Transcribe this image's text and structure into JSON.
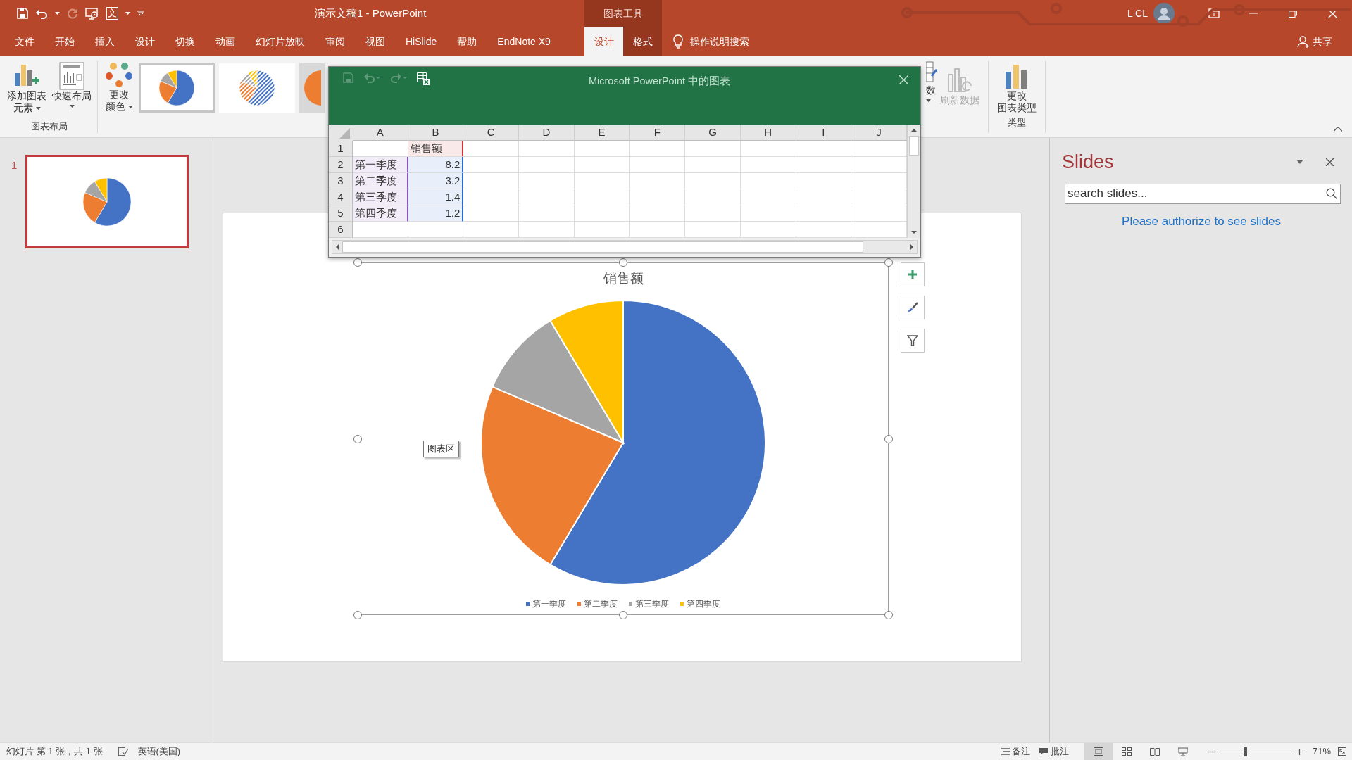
{
  "quick_access": {
    "glyph": "文"
  },
  "window": {
    "title": "演示文稿1  -  PowerPoint",
    "context": "图表工具",
    "user": "L CL"
  },
  "tabs": [
    {
      "label": "文件",
      "kind": "normal",
      "selected": false
    },
    {
      "label": "开始",
      "kind": "normal",
      "selected": false
    },
    {
      "label": "插入",
      "kind": "normal",
      "selected": false
    },
    {
      "label": "设计",
      "kind": "normal",
      "selected": false
    },
    {
      "label": "切换",
      "kind": "normal",
      "selected": false
    },
    {
      "label": "动画",
      "kind": "normal",
      "selected": false
    },
    {
      "label": "幻灯片放映",
      "kind": "normal",
      "selected": false
    },
    {
      "label": "审阅",
      "kind": "normal",
      "selected": false
    },
    {
      "label": "视图",
      "kind": "normal",
      "selected": false
    },
    {
      "label": "HiSlide",
      "kind": "normal",
      "selected": false
    },
    {
      "label": "帮助",
      "kind": "normal",
      "selected": false
    },
    {
      "label": "EndNote X9",
      "kind": "normal",
      "selected": false
    },
    {
      "label": "设计",
      "kind": "context",
      "selected": true
    },
    {
      "label": "格式",
      "kind": "context",
      "selected": false
    }
  ],
  "tell_me": "操作说明搜索",
  "share": "共享",
  "ribbon": {
    "layout_group": {
      "label": "图表布局",
      "buttons": [
        {
          "kind": "add-element",
          "lines": [
            "添加图表",
            "元素"
          ],
          "dropdown": true
        },
        {
          "kind": "quick-layout",
          "lines": [
            "快速布局"
          ],
          "dropdown": true
        }
      ]
    },
    "color_button": {
      "lines": [
        "更改",
        "颜色"
      ],
      "dropdown": true
    },
    "styles": [
      {
        "kind": "solid",
        "selected": true
      },
      {
        "kind": "hatched",
        "selected": false
      },
      {
        "kind": "shaded",
        "selected": false
      }
    ],
    "data_button": {
      "text": "数",
      "dropdown": true
    },
    "refresh_button": {
      "label": "刷新数据",
      "disabled": true
    },
    "type_group": {
      "label": "类型",
      "lines": [
        "更改",
        "图表类型"
      ]
    }
  },
  "excel": {
    "title": "Microsoft PowerPoint 中的图表",
    "columns": [
      "A",
      "B",
      "C",
      "D",
      "E",
      "F",
      "G",
      "H",
      "I",
      "J"
    ],
    "rows": [
      {
        "label": "1",
        "cells": {
          "B": {
            "text": "销售额",
            "color": "#d13438"
          }
        }
      },
      {
        "label": "2",
        "cells": {
          "A": {
            "text": "第一季度",
            "color": "#8854c0"
          },
          "B": {
            "text": "8.2",
            "color": "#2b6bd1"
          }
        }
      },
      {
        "label": "3",
        "cells": {
          "A": {
            "text": "第二季度",
            "color": "#8854c0"
          },
          "B": {
            "text": "3.2",
            "color": "#2b6bd1"
          }
        }
      },
      {
        "label": "4",
        "cells": {
          "A": {
            "text": "第三季度",
            "color": "#8854c0"
          },
          "B": {
            "text": "1.4",
            "color": "#2b6bd1"
          }
        }
      },
      {
        "label": "5",
        "cells": {
          "A": {
            "text": "第四季度",
            "color": "#8854c0"
          },
          "B": {
            "text": "1.2",
            "color": "#2b6bd1"
          }
        }
      },
      {
        "label": "6",
        "cells": {}
      }
    ]
  },
  "thumbnails": [
    {
      "number": "1",
      "selected": true
    }
  ],
  "slide": {
    "chart_data": {
      "type": "pie",
      "title": "销售额",
      "categories": [
        "第一季度",
        "第二季度",
        "第三季度",
        "第四季度"
      ],
      "values": [
        58.57,
        22.86,
        10,
        8.57
      ],
      "legend": "bottom"
    },
    "slices": [
      {
        "color": "#4472c4"
      },
      {
        "color": "#ed7d31"
      },
      {
        "color": "#a5a5a5"
      },
      {
        "color": "#ffc000"
      }
    ],
    "tooltip": "图表区"
  },
  "slides_pane": {
    "title": "Slides",
    "placeholder": "search slides...",
    "message": "Please authorize to see slides"
  },
  "status_bar": {
    "slide_info": "幻灯片 第 1 张，共 1 张",
    "language": "英语(美国)",
    "notes": "备注",
    "comments": "批注",
    "views": [
      {
        "kind": "normal",
        "selected": true
      },
      {
        "kind": "sorter",
        "selected": false
      },
      {
        "kind": "reading",
        "selected": false
      },
      {
        "kind": "show",
        "selected": false
      }
    ],
    "zoom": {
      "level": 0.37
    },
    "zoom_text": "71%"
  }
}
